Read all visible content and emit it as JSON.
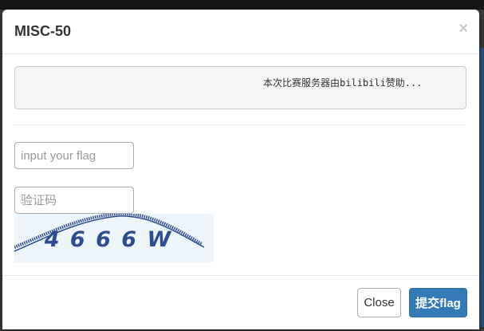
{
  "modal": {
    "title": "MISC-50",
    "close_icon_glyph": "×",
    "hint": "本次比赛服务器由bilibili赞助...",
    "flag_placeholder": "input your flag",
    "captcha_placeholder": "验证码",
    "captcha_text": "4 6 6 6 W",
    "close_label": "Close",
    "submit_label": "提交flag"
  },
  "colors": {
    "primary": "#337ab7",
    "captcha_ink": "#2f4c8f",
    "captcha_bg": "#eef5fb"
  }
}
